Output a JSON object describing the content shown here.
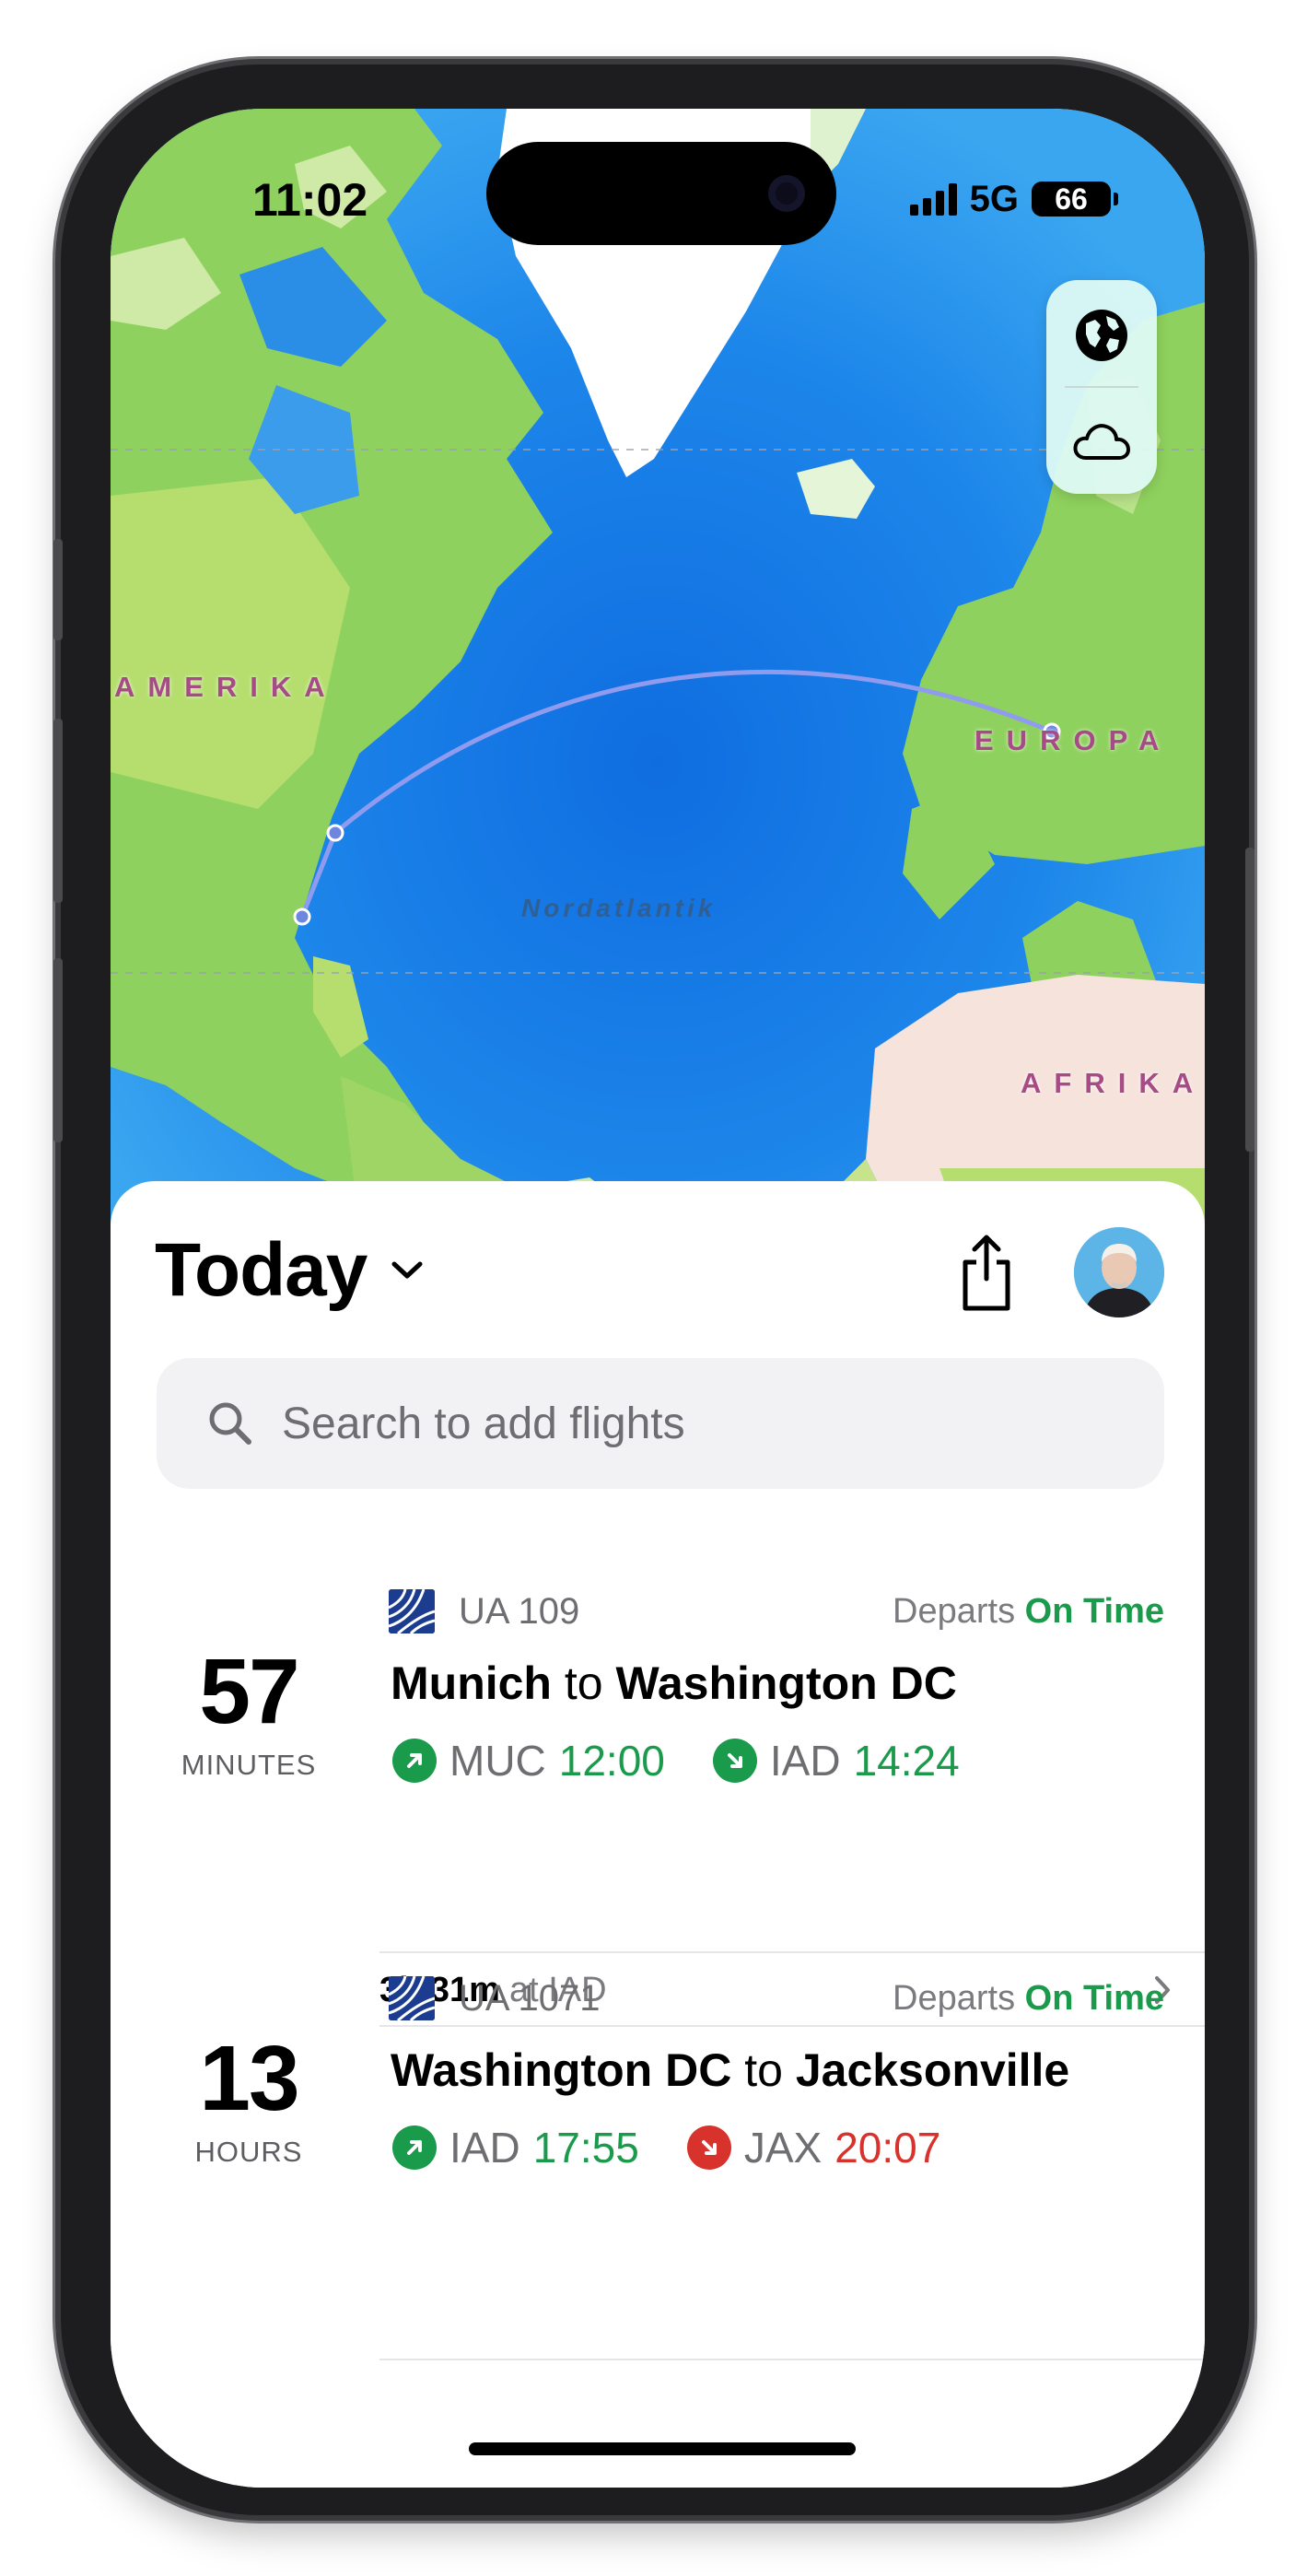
{
  "status_bar": {
    "time": "11:02",
    "network": "5G",
    "battery": "66"
  },
  "map": {
    "labels": {
      "north_america": "AMERIKA",
      "europe": "EUROPA",
      "africa": "AFRIKA",
      "ocean": "Nordatlantik"
    },
    "controls": {
      "globe": "globe-icon",
      "weather": "cloud-icon"
    }
  },
  "header": {
    "title": "Today"
  },
  "search": {
    "placeholder": "Search to add flights"
  },
  "flights": [
    {
      "countdown": "57",
      "countdown_unit": "MINUTES",
      "number": "UA 109",
      "status_prefix": "Departs",
      "status": "On Time",
      "from_city": "Munich",
      "connector": "to",
      "to_city": "Washington DC",
      "dep_code": "MUC",
      "dep_time": "12:00",
      "arr_code": "IAD",
      "arr_time": "14:24"
    },
    {
      "countdown": "13",
      "countdown_unit": "HOURS",
      "number": "UA 1071",
      "status_prefix": "Departs",
      "status": "On Time",
      "from_city": "Washington DC",
      "connector": "to",
      "to_city": "Jacksonville",
      "dep_code": "IAD",
      "dep_time": "17:55",
      "arr_code": "JAX",
      "arr_time": "20:07"
    }
  ],
  "layover": {
    "duration": "3h 31m",
    "at": "at IAD"
  },
  "colors": {
    "on_time": "#1a9a4b",
    "late": "#d7322c",
    "route_arc": "#8f9bef"
  }
}
